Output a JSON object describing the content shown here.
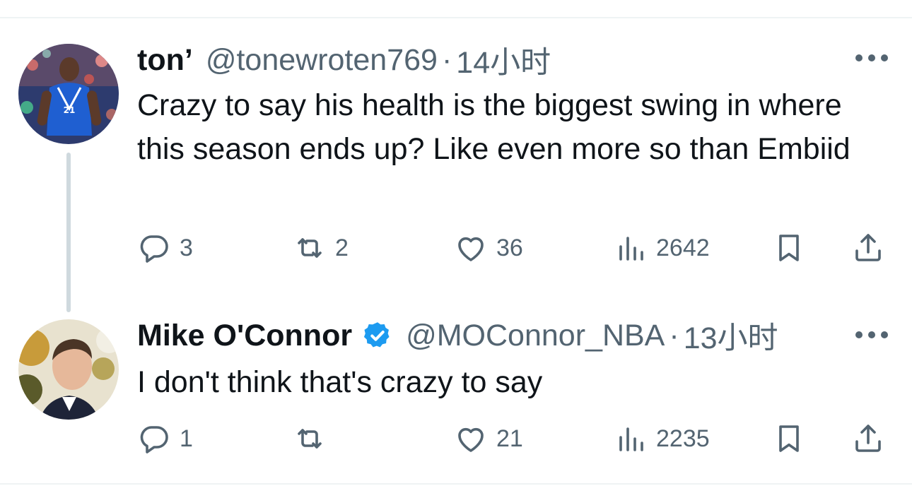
{
  "tweets": [
    {
      "display_name": "ton’",
      "handle": "@tonewroten769",
      "separator": "·",
      "time": "14小时",
      "verified": false,
      "text": "Crazy to say his health is the biggest swing in where this season ends up? Like even more so than Embiid",
      "replies": "3",
      "reposts": "2",
      "likes": "36",
      "views": "2642"
    },
    {
      "display_name": "Mike O'Connor",
      "handle": "@MOConnor_NBA",
      "separator": "·",
      "time": "13小时",
      "verified": true,
      "text": "I don't think that's crazy to say",
      "replies": "1",
      "reposts": "",
      "likes": "21",
      "views": "2235"
    }
  ],
  "icons": {
    "reply": "reply-icon",
    "repost": "repost-icon",
    "like": "heart-icon",
    "views": "views-icon",
    "bookmark": "bookmark-icon",
    "share": "share-icon",
    "more": "more-icon",
    "verified": "verified-badge-icon"
  },
  "colors": {
    "text": "#0f1419",
    "secondary": "#536471",
    "verified": "#1d9bf0",
    "divider": "#eff3f4",
    "thread_line": "#cfd9de"
  }
}
